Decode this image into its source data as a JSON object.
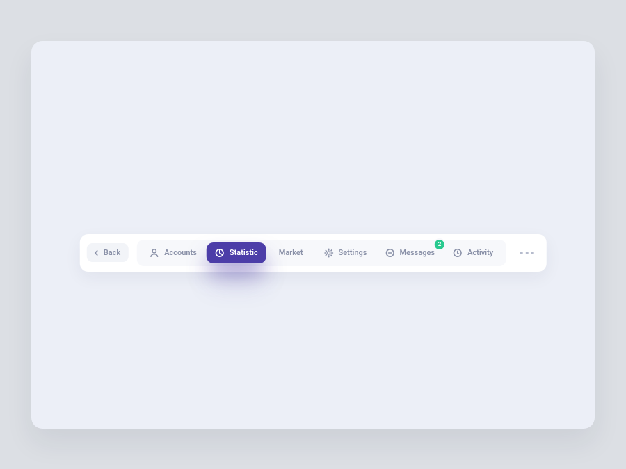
{
  "back": {
    "label": "Back"
  },
  "tabs": [
    {
      "id": "accounts",
      "label": "Accounts",
      "icon": "user-icon",
      "active": false
    },
    {
      "id": "statistic",
      "label": "Statistic",
      "icon": "pie-icon",
      "active": true
    },
    {
      "id": "market",
      "label": "Market",
      "icon": null,
      "active": false
    },
    {
      "id": "settings",
      "label": "Settings",
      "icon": "gear-icon",
      "active": false
    },
    {
      "id": "messages",
      "label": "Messages",
      "icon": "message-icon",
      "active": false,
      "badge": "2"
    },
    {
      "id": "activity",
      "label": "Activity",
      "icon": "clock-icon",
      "active": false
    }
  ],
  "colors": {
    "accent": "#4c3da8",
    "badge": "#28c98f",
    "muted": "#8a91a8"
  }
}
